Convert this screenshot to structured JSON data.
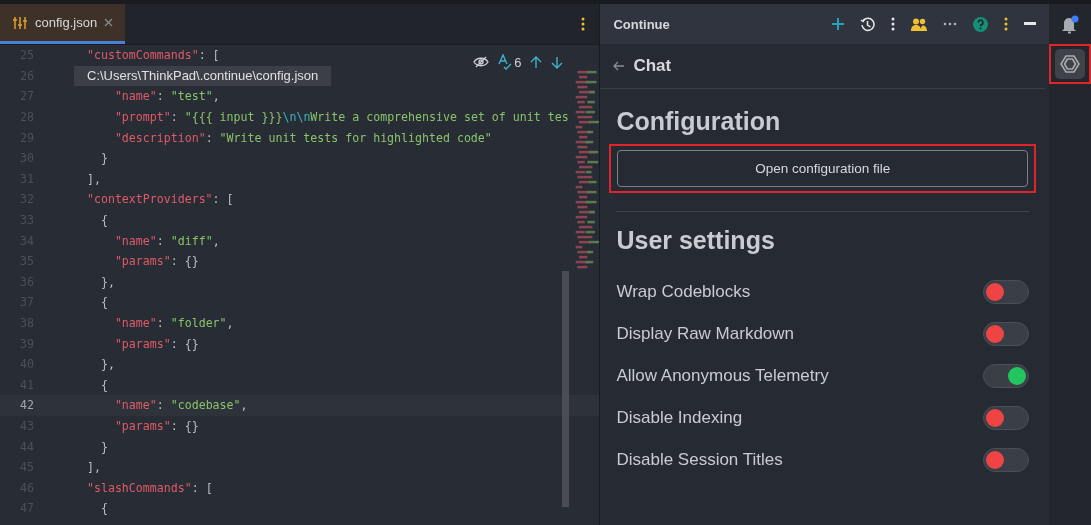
{
  "editor": {
    "tab": {
      "label": "config.json",
      "selected": true
    },
    "tooltip": "C:\\Users\\ThinkPad\\.continue\\config.json",
    "find_count": "6",
    "lines": [
      {
        "number": "25",
        "current": false,
        "tokens": [
          {
            "kind": "key",
            "text": "  \"customCommands\""
          },
          {
            "kind": "punct",
            "text": ": ["
          }
        ]
      },
      {
        "number": "26",
        "current": false
      },
      {
        "number": "27",
        "current": false,
        "tokens": [
          {
            "kind": "key",
            "text": "      \"name\""
          },
          {
            "kind": "punct",
            "text": ": "
          },
          {
            "kind": "str",
            "text": "\"test\""
          },
          {
            "kind": "punct",
            "text": ","
          }
        ]
      },
      {
        "number": "28",
        "current": false,
        "tokens": [
          {
            "kind": "key",
            "text": "      \"prompt\""
          },
          {
            "kind": "punct",
            "text": ": "
          },
          {
            "kind": "str",
            "text": "\"{{{ input }}}"
          },
          {
            "kind": "esc",
            "text": "\\n\\n"
          },
          {
            "kind": "str",
            "text": "Write a comprehensive set of unit tes"
          }
        ]
      },
      {
        "number": "29",
        "current": false,
        "tokens": [
          {
            "kind": "key",
            "text": "      \"description\""
          },
          {
            "kind": "punct",
            "text": ": "
          },
          {
            "kind": "str",
            "text": "\"Write unit tests for highlighted code\""
          }
        ]
      },
      {
        "number": "30",
        "current": false,
        "tokens": [
          {
            "kind": "punct",
            "text": "    }"
          }
        ]
      },
      {
        "number": "31",
        "current": false,
        "tokens": [
          {
            "kind": "punct",
            "text": "  ],"
          }
        ]
      },
      {
        "number": "32",
        "current": false,
        "tokens": [
          {
            "kind": "key",
            "text": "  \"contextProviders\""
          },
          {
            "kind": "punct",
            "text": ": ["
          }
        ]
      },
      {
        "number": "33",
        "current": false,
        "tokens": [
          {
            "kind": "punct",
            "text": "    {"
          }
        ]
      },
      {
        "number": "34",
        "current": false,
        "tokens": [
          {
            "kind": "key",
            "text": "      \"name\""
          },
          {
            "kind": "punct",
            "text": ": "
          },
          {
            "kind": "str",
            "text": "\"diff\""
          },
          {
            "kind": "punct",
            "text": ","
          }
        ]
      },
      {
        "number": "35",
        "current": false,
        "tokens": [
          {
            "kind": "key",
            "text": "      \"params\""
          },
          {
            "kind": "punct",
            "text": ": {}"
          }
        ]
      },
      {
        "number": "36",
        "current": false,
        "tokens": [
          {
            "kind": "punct",
            "text": "    },"
          }
        ]
      },
      {
        "number": "37",
        "current": false,
        "tokens": [
          {
            "kind": "punct",
            "text": "    {"
          }
        ]
      },
      {
        "number": "38",
        "current": false,
        "tokens": [
          {
            "kind": "key",
            "text": "      \"name\""
          },
          {
            "kind": "punct",
            "text": ": "
          },
          {
            "kind": "str",
            "text": "\"folder\""
          },
          {
            "kind": "punct",
            "text": ","
          }
        ]
      },
      {
        "number": "39",
        "current": false,
        "tokens": [
          {
            "kind": "key",
            "text": "      \"params\""
          },
          {
            "kind": "punct",
            "text": ": {}"
          }
        ]
      },
      {
        "number": "40",
        "current": false,
        "tokens": [
          {
            "kind": "punct",
            "text": "    },"
          }
        ]
      },
      {
        "number": "41",
        "current": false,
        "tokens": [
          {
            "kind": "punct",
            "text": "    {"
          }
        ]
      },
      {
        "number": "42",
        "current": true,
        "tokens": [
          {
            "kind": "key",
            "text": "      \"name\""
          },
          {
            "kind": "punct",
            "text": ": "
          },
          {
            "kind": "str",
            "text": "\"codebase\""
          },
          {
            "kind": "punct",
            "text": ","
          }
        ]
      },
      {
        "number": "43",
        "current": false,
        "tokens": [
          {
            "kind": "key",
            "text": "      \"params\""
          },
          {
            "kind": "punct",
            "text": ": {}"
          }
        ]
      },
      {
        "number": "44",
        "current": false,
        "tokens": [
          {
            "kind": "punct",
            "text": "    }"
          }
        ]
      },
      {
        "number": "45",
        "current": false,
        "tokens": [
          {
            "kind": "punct",
            "text": "  ],"
          }
        ]
      },
      {
        "number": "46",
        "current": false,
        "tokens": [
          {
            "kind": "key",
            "text": "  \"slashCommands\""
          },
          {
            "kind": "punct",
            "text": ": ["
          }
        ]
      },
      {
        "number": "47",
        "current": false,
        "tokens": [
          {
            "kind": "punct",
            "text": "    {"
          }
        ]
      }
    ]
  },
  "panel": {
    "title": "Continue",
    "back_label": "Chat",
    "configuration": {
      "heading": "Configuration",
      "button": "Open configuration file",
      "highlighted": true
    },
    "user_settings": {
      "heading": "User settings",
      "settings": [
        {
          "label": "Wrap Codeblocks",
          "on": false
        },
        {
          "label": "Display Raw Markdown",
          "on": false
        },
        {
          "label": "Allow Anonymous Telemetry",
          "on": true
        },
        {
          "label": "Disable Indexing",
          "on": false
        },
        {
          "label": "Disable Session Titles",
          "on": false
        }
      ]
    }
  },
  "sidebar": {
    "notification_unread": true,
    "continue_selected": true,
    "continue_highlighted": true
  }
}
